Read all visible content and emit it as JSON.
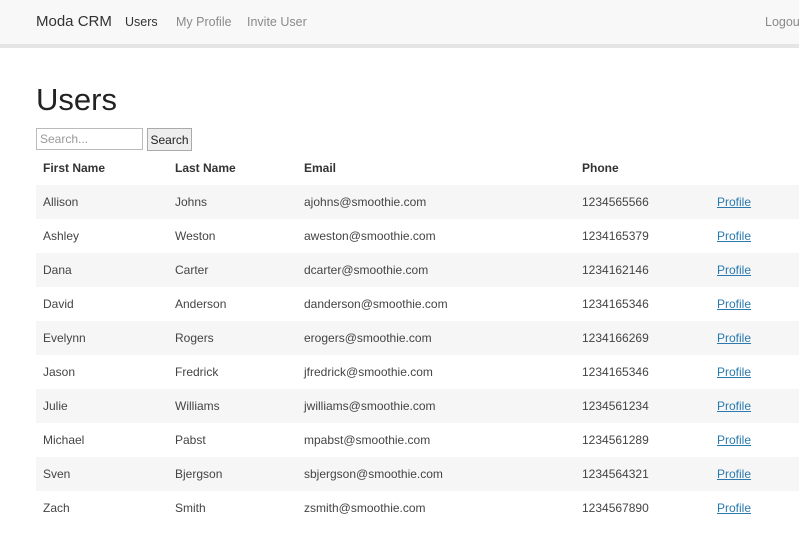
{
  "navbar": {
    "brand": "Moda CRM",
    "links": {
      "users": "Users",
      "my_profile": "My Profile",
      "invite_user": "Invite User",
      "logout": "Logout"
    }
  },
  "main": {
    "title": "Users",
    "search": {
      "placeholder": "Search...",
      "value": "",
      "button_label": "Search"
    },
    "table": {
      "headers": {
        "first_name": "First Name",
        "last_name": "Last Name",
        "email": "Email",
        "phone": "Phone",
        "action": ""
      },
      "rows": [
        {
          "first": "Allison",
          "last": "Johns",
          "email": "ajohns@smoothie.com",
          "phone": "1234565566",
          "link": "Profile"
        },
        {
          "first": "Ashley",
          "last": "Weston",
          "email": "aweston@smoothie.com",
          "phone": "1234165379",
          "link": "Profile"
        },
        {
          "first": "Dana",
          "last": "Carter",
          "email": "dcarter@smoothie.com",
          "phone": "1234162146",
          "link": "Profile"
        },
        {
          "first": "David",
          "last": "Anderson",
          "email": "danderson@smoothie.com",
          "phone": "1234165346",
          "link": "Profile"
        },
        {
          "first": "Evelynn",
          "last": "Rogers",
          "email": "erogers@smoothie.com",
          "phone": "1234166269",
          "link": "Profile"
        },
        {
          "first": "Jason",
          "last": "Fredrick",
          "email": "jfredrick@smoothie.com",
          "phone": "1234165346",
          "link": "Profile"
        },
        {
          "first": "Julie",
          "last": "Williams",
          "email": "jwilliams@smoothie.com",
          "phone": "1234561234",
          "link": "Profile"
        },
        {
          "first": "Michael",
          "last": "Pabst",
          "email": "mpabst@smoothie.com",
          "phone": "1234561289",
          "link": "Profile"
        },
        {
          "first": "Sven",
          "last": "Bjergson",
          "email": "sbjergson@smoothie.com",
          "phone": "1234564321",
          "link": "Profile"
        },
        {
          "first": "Zach",
          "last": "Smith",
          "email": "zsmith@smoothie.com",
          "phone": "1234567890",
          "link": "Profile"
        }
      ]
    }
  }
}
